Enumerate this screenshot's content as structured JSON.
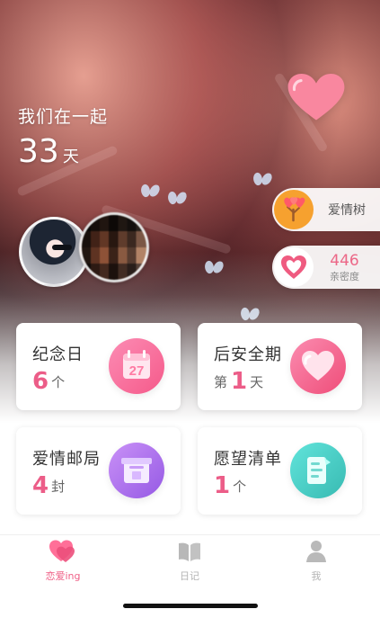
{
  "relationship": {
    "title": "我们在一起",
    "days_value": "33",
    "days_unit": "天"
  },
  "side_panel": {
    "tree_label": "爱情树",
    "intimacy_value": "446",
    "intimacy_label": "亲密度"
  },
  "cards": {
    "anniversary": {
      "title": "纪念日",
      "value": "6",
      "unit": "个",
      "calendar_day": "27"
    },
    "safe_period": {
      "title": "后安全期",
      "prefix": "第",
      "value": "1",
      "unit": "天"
    },
    "love_post": {
      "title": "爱情邮局",
      "value": "4",
      "unit": "封"
    },
    "wish_list": {
      "title": "愿望清单",
      "value": "1",
      "unit": "个"
    }
  },
  "tabs": {
    "love": "恋爱ing",
    "diary": "日记",
    "me": "我"
  },
  "colors": {
    "accent_pink": "#ec5d88",
    "icon_pink": "#f55a8a",
    "icon_purple": "#9559e4",
    "icon_teal": "#38bab2",
    "tree_orange": "#f6a12f"
  },
  "icons": {
    "top": "heart-icon",
    "tree": "love-tree-icon",
    "intimacy": "heart-outline-icon",
    "anniversary": "calendar-icon",
    "safe_period": "heart-icon",
    "love_post": "mailbox-icon",
    "wish_list": "wish-list-icon",
    "tab_love": "heart-tab-icon",
    "tab_diary": "book-icon",
    "tab_me": "person-icon"
  }
}
